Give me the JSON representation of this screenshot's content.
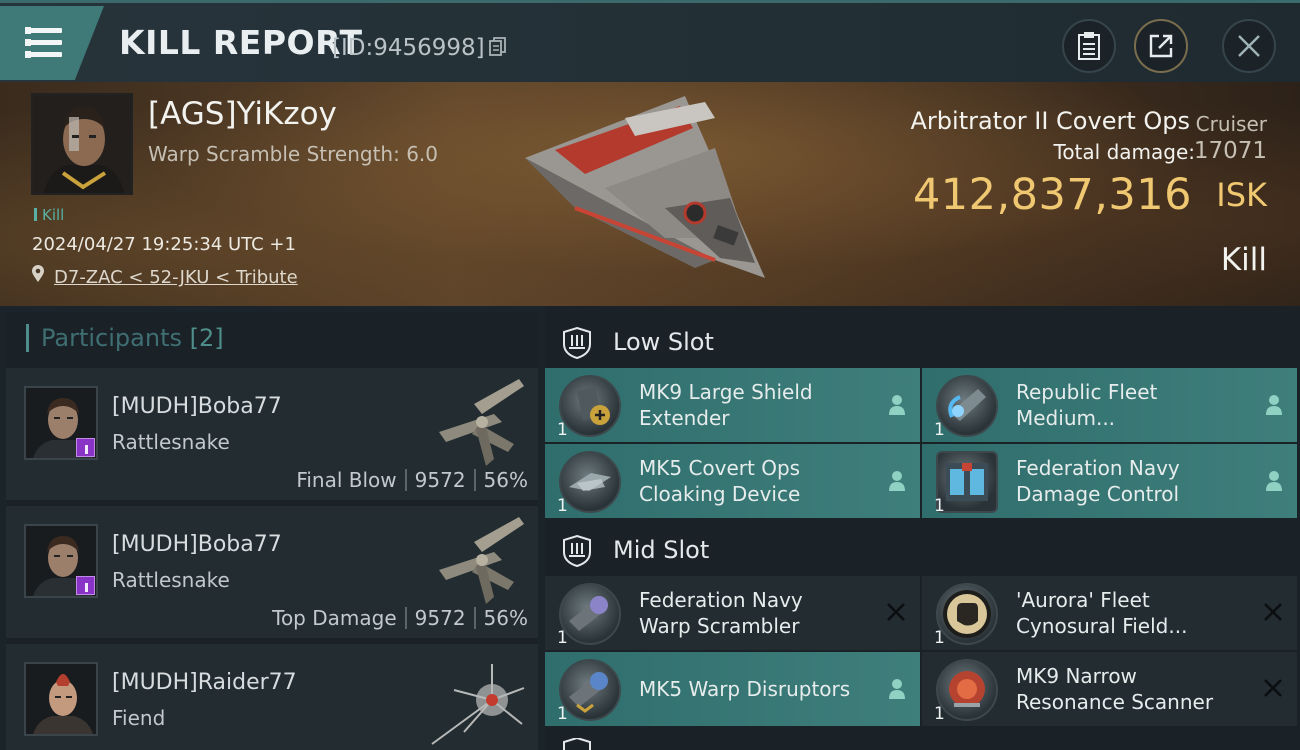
{
  "header": {
    "title": "KILL REPORT",
    "report_id": "[ID:9456998]"
  },
  "victim": {
    "name": "[AGS]YiKzoy",
    "warp_scramble": "Warp Scramble Strength: 6.0",
    "kill_tag": "Kill",
    "timestamp": "2024/04/27 19:25:34 UTC +1",
    "location": "D7-ZAC < 52-JKU < Tribute",
    "ship_name": "Arbitrator II Covert Ops",
    "ship_class": "Cruiser",
    "total_damage_label": "Total damage:",
    "total_damage": "17071",
    "isk_value": "412,837,316",
    "isk_unit": "ISK",
    "result": "Kill"
  },
  "participants": {
    "title": "Participants",
    "count": "[2]",
    "items": [
      {
        "name": "[MUDH]Boba77",
        "ship": "Rattlesnake",
        "role": "Final Blow",
        "damage": "9572",
        "percent": "56%"
      },
      {
        "name": "[MUDH]Boba77",
        "ship": "Rattlesnake",
        "role": "Top Damage",
        "damage": "9572",
        "percent": "56%"
      },
      {
        "name": "[MUDH]Raider77",
        "ship": "Fiend",
        "role": "",
        "damage": "",
        "percent": ""
      }
    ]
  },
  "slots": {
    "low": {
      "label": "Low Slot",
      "modules": [
        {
          "line1": "MK9 Large Shield",
          "line2": "Extender",
          "qty": "1",
          "state": "dropped"
        },
        {
          "line1": "Republic Fleet",
          "line2": "Medium...",
          "qty": "1",
          "state": "dropped"
        },
        {
          "line1": "MK5 Covert Ops",
          "line2": "Cloaking Device",
          "qty": "1",
          "state": "dropped"
        },
        {
          "line1": "Federation Navy",
          "line2": "Damage Control",
          "qty": "1",
          "state": "dropped"
        }
      ]
    },
    "mid": {
      "label": "Mid Slot",
      "modules": [
        {
          "line1": "Federation Navy",
          "line2": "Warp Scrambler",
          "qty": "1",
          "state": "destroyed"
        },
        {
          "line1": "'Aurora' Fleet",
          "line2": "Cynosural Field...",
          "qty": "1",
          "state": "destroyed"
        },
        {
          "line1": "MK5 Warp Disruptors",
          "line2": "",
          "qty": "1",
          "state": "dropped"
        },
        {
          "line1": "MK9 Narrow",
          "line2": "Resonance Scanner",
          "qty": "1",
          "state": "destroyed"
        }
      ]
    }
  },
  "colors": {
    "accent_teal": "#3e7e7b",
    "isk_gold": "#efc871",
    "kill_green": "#58b1a4",
    "badge_purple": "#8a33c7"
  },
  "icons": {
    "menu": "hamburger-menu-icon",
    "copy": "copy-icon",
    "clipboard": "clipboard-icon",
    "share": "share-icon",
    "close": "close-icon",
    "location": "map-pin-icon",
    "slot": "shield-slot-icon",
    "dropped": "person-icon",
    "destroyed": "x-icon"
  }
}
